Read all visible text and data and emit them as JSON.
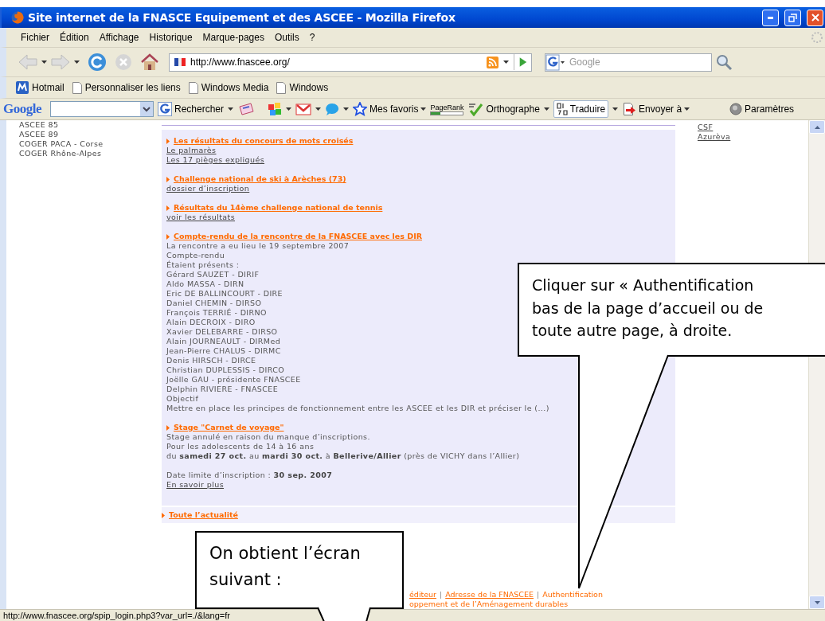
{
  "window": {
    "title": "Site internet de la FNASCE Equipement et des ASCEE - Mozilla Firefox"
  },
  "menu": [
    "Fichier",
    "Édition",
    "Affichage",
    "Historique",
    "Marque-pages",
    "Outils",
    "?"
  ],
  "navigation": {
    "url": "http://www.fnascee.org/",
    "search_placeholder": "Google"
  },
  "bookmarks": [
    "Hotmail",
    "Personnaliser les liens",
    "Windows Media",
    "Windows"
  ],
  "google_toolbar": {
    "logo": "Google",
    "buttons": [
      {
        "label": "Rechercher",
        "kind": "search"
      },
      {
        "label": "Mes favoris",
        "kind": "favorites"
      },
      {
        "label": "PageRank",
        "kind": "pagerank",
        "level": 0.3
      },
      {
        "label": "Orthographe",
        "kind": "spell"
      },
      {
        "label": "Traduire",
        "kind": "translate"
      },
      {
        "label": "Envoyer à",
        "kind": "send"
      },
      {
        "label": "Paramètres",
        "kind": "settings"
      }
    ]
  },
  "left_links": [
    "ASCEE 85",
    "ASCEE 89",
    "COGER PACA - Corse",
    "COGER Rhône-Alpes"
  ],
  "news": [
    {
      "title": "Les résultats du concours de mots croisés",
      "lines": [
        {
          "text": "Le palmarès",
          "kind": "link"
        },
        {
          "text": "Les 17 pièges expliqués",
          "kind": "link"
        }
      ]
    },
    {
      "title": "Challenge national de ski à Arèches (73)",
      "lines": [
        {
          "text": "dossier d’inscription",
          "kind": "link"
        }
      ]
    },
    {
      "title": "Résultats du 14ème challenge national de tennis",
      "lines": [
        {
          "text": "voir les résultats",
          "kind": "link"
        }
      ]
    },
    {
      "title": "Compte-rendu de la rencontre de la FNASCEE avec les DIR",
      "lines": [
        {
          "text": "La rencontre a eu lieu le 19 septembre 2007",
          "kind": "text"
        },
        {
          "text": "Compte-rendu",
          "kind": "text"
        },
        {
          "text": "Étaient présents :",
          "kind": "text"
        },
        {
          "text": "Gérard SAUZET - DIRIF",
          "kind": "text"
        },
        {
          "text": "Aldo MASSA - DIRN",
          "kind": "text"
        },
        {
          "text": "Eric DE BALLINCOURT - DIRE",
          "kind": "text"
        },
        {
          "text": "Daniel CHEMIN - DIRSO",
          "kind": "text"
        },
        {
          "text": "François TERRIÉ - DIRNO",
          "kind": "text"
        },
        {
          "text": "Alain DECROIX - DIRO",
          "kind": "text"
        },
        {
          "text": "Xavier DELEBARRE - DIRSO",
          "kind": "text"
        },
        {
          "text": "Alain JOURNEAULT - DIRMed",
          "kind": "text"
        },
        {
          "text": "Jean-Pierre CHALUS - DIRMC",
          "kind": "text"
        },
        {
          "text": "Denis HIRSCH - DIRCE",
          "kind": "text"
        },
        {
          "text": "Christian DUPLESSIS - DIRCO",
          "kind": "text"
        },
        {
          "text": "Joëlle GAU - présidente FNASCEE",
          "kind": "text"
        },
        {
          "text": "Delphin RIVIERE - FNASCEE",
          "kind": "text"
        },
        {
          "text": "Objectif",
          "kind": "text"
        },
        {
          "text": "Mettre en place les principes de fonctionnement entre les ASCEE et les DIR et préciser le (...)",
          "kind": "text"
        }
      ]
    },
    {
      "title": "Stage \"Carnet de voyage\"",
      "lines": [
        {
          "text": "Stage annulé en raison du manque d’inscriptions.",
          "kind": "text"
        },
        {
          "text": "Pour les adolescents de 14 à 16 ans",
          "kind": "text"
        },
        {
          "text": "du **samedi 27 oct.** au **mardi 30 oct.** à **Bellerive/Allier** (près de VICHY dans l’Allier)",
          "kind": "text"
        },
        {
          "text": "Date limite d’inscription : **30 sep. 2007**",
          "kind": "gap-text"
        },
        {
          "text": "En savoir plus",
          "kind": "link"
        }
      ]
    }
  ],
  "all_news": "Toute l’actualité",
  "right_links": [
    "CSF",
    "Azurèva"
  ],
  "footer": {
    "links": [
      {
        "text": "éditeur",
        "kind": "link"
      },
      {
        "text": "Adresse de la FNASCEE",
        "kind": "link"
      },
      {
        "text": "Authentification",
        "kind": "plain"
      }
    ],
    "separator": "|",
    "line_2": "oppement et de l’Aménagement durables"
  },
  "status_bar": "http://www.fnascee.org/spip_login.php3?var_url=./&lang=fr",
  "callouts": [
    {
      "text": "Cliquer sur « Authentification\nbas de la page d’accueil ou de\ntoute autre page, à droite.",
      "kind": "upper"
    },
    {
      "text": "On obtient l’écran\nsuivant :",
      "kind": "lower"
    }
  ]
}
